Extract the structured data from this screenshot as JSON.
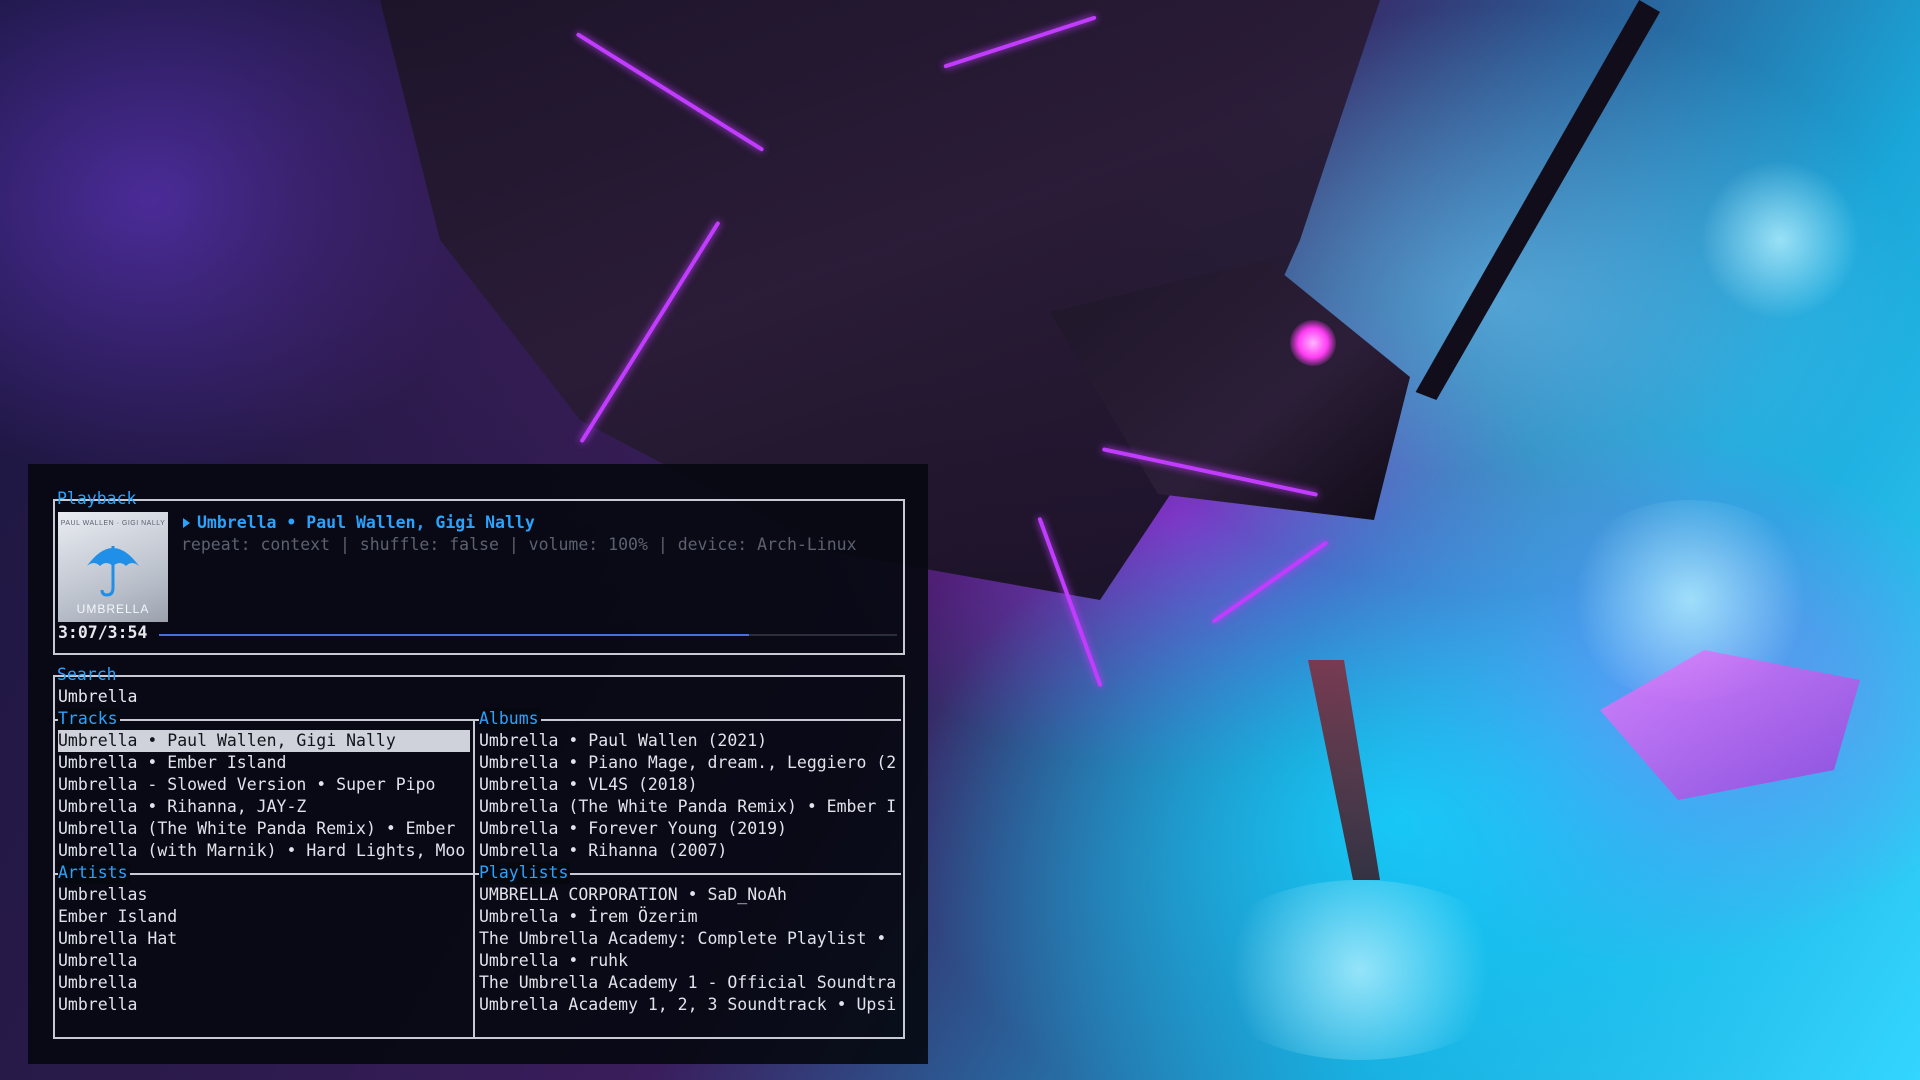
{
  "playback": {
    "title": "Playback",
    "play_icon": "play-triangle-icon",
    "now_playing": "Umbrella • Paul Wallen, Gigi Nally",
    "status": "repeat: context | shuffle: false | volume: 100% | device: Arch-Linux",
    "progress": "3:07/3:54",
    "progress_ratio": 0.8,
    "cover": {
      "header": "PAUL WALLEN · GIGI NALLY",
      "footer": "UMBRELLA",
      "icon": "umbrella-icon"
    }
  },
  "search": {
    "title": "Search",
    "query": "Umbrella",
    "tracks": {
      "title": "Tracks",
      "items": [
        "Umbrella • Paul Wallen, Gigi Nally",
        "Umbrella • Ember Island",
        "Umbrella - Slowed Version • Super Pipo",
        "Umbrella • Rihanna, JAY-Z",
        "Umbrella (The White Panda Remix) • Ember",
        "Umbrella (with Marnik) • Hard Lights, Moo"
      ],
      "selected_index": 0
    },
    "albums": {
      "title": "Albums",
      "items": [
        "Umbrella • Paul Wallen (2021)",
        "Umbrella • Piano Mage, dream., Leggiero (2",
        "Umbrella • VL4S (2018)",
        "Umbrella (The White Panda Remix) • Ember I",
        "Umbrella • Forever Young (2019)",
        "Umbrella • Rihanna (2007)"
      ]
    },
    "artists": {
      "title": "Artists",
      "items": [
        "Umbrellas",
        "Ember Island",
        "Umbrella Hat",
        "Umbrella",
        "Umbrella",
        "Umbrella"
      ]
    },
    "playlists": {
      "title": "Playlists",
      "items": [
        "UMBRELLA CORPORATION • SaD_NoAh",
        "Umbrella • İrem Özerim",
        "The Umbrella Academy: Complete Playlist •",
        "Umbrella • ruhk",
        "The Umbrella Academy 1 - Official Soundtra",
        "Umbrella Academy 1, 2, 3 Soundtrack • Upsi"
      ]
    }
  },
  "colors": {
    "accent": "#2aa3ff",
    "text": "#e0e3ea",
    "muted": "#5c6170",
    "border": "#c7cad3",
    "selection_bg": "#cfd2da",
    "progress": "#4a6de0"
  }
}
